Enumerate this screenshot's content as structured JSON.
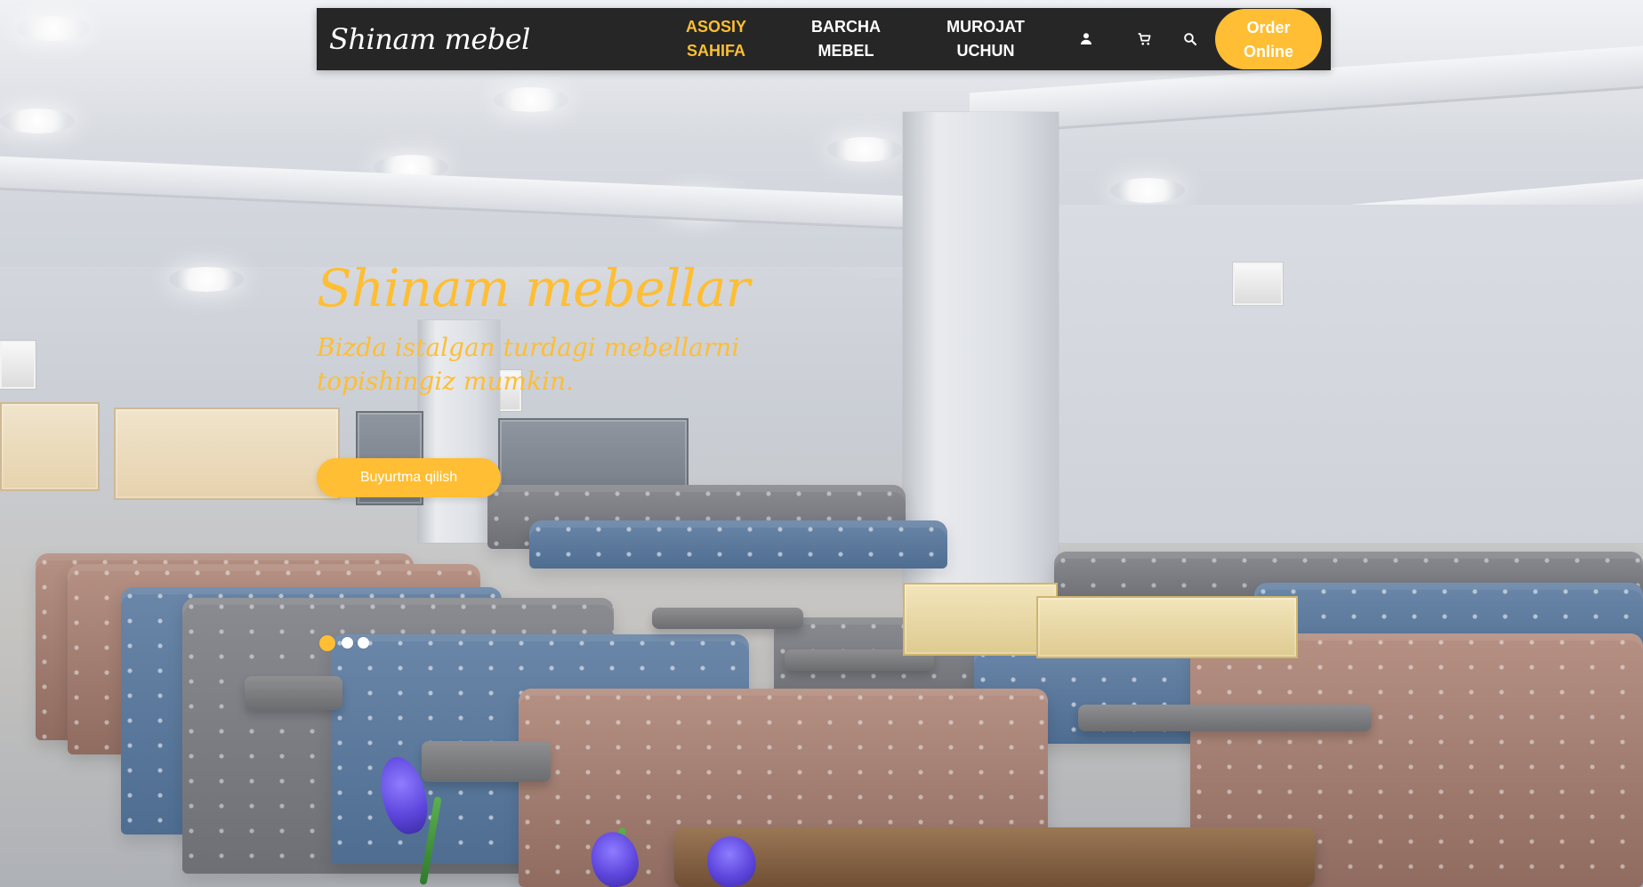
{
  "header": {
    "brand": "Shinam mebel",
    "nav": [
      {
        "label": "ASOSIY\nSAHIFA",
        "active": true
      },
      {
        "label": "BARCHA\nMEBEL",
        "active": false
      },
      {
        "label": "MUROJAT\nUCHUN",
        "active": false
      }
    ],
    "icons": {
      "user": "user-icon",
      "cart": "cart-icon",
      "search": "search-icon"
    },
    "order_button": "Order\nOnline"
  },
  "hero": {
    "title": "Shinam mebellar",
    "subtitle": "Bizda istalgan turdagi mebellarni topishingiz mumkin.",
    "cta": "Buyurtma qilish",
    "slides": {
      "active_index": 0,
      "count": 3
    }
  },
  "colors": {
    "accent": "#ffbe33",
    "nav_bg": "#262626",
    "text_light": "#ffffff"
  }
}
